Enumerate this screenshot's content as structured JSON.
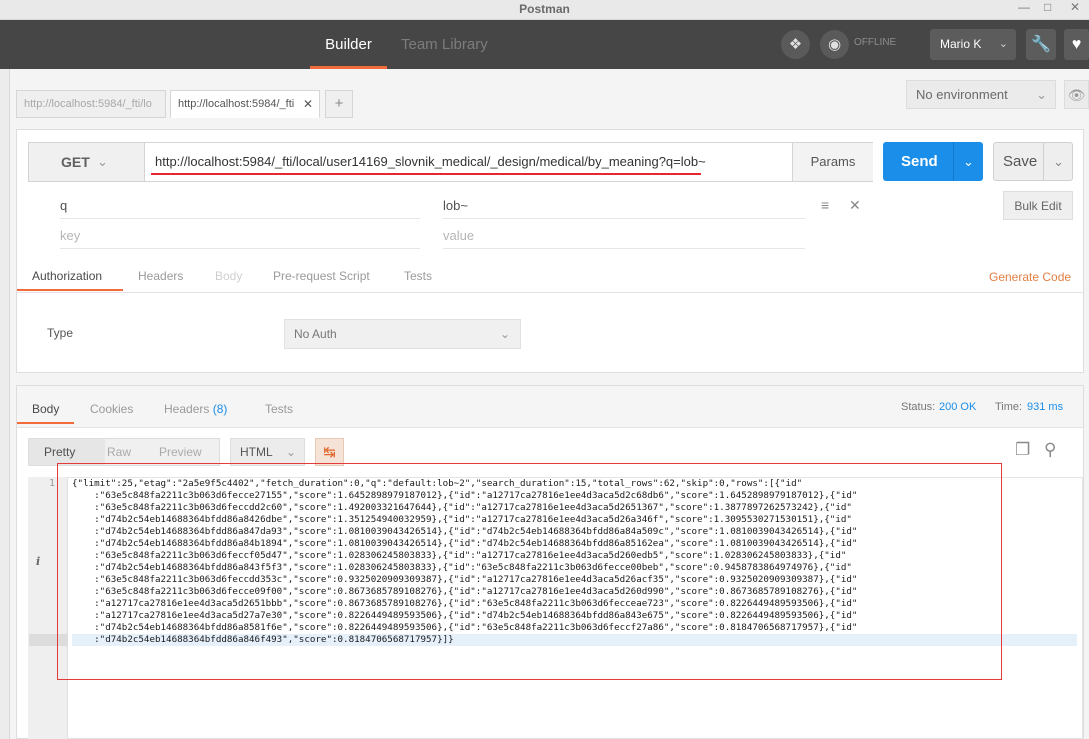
{
  "window": {
    "title": "Postman"
  },
  "nav": {
    "tabs": [
      {
        "label": "Builder"
      },
      {
        "label": "Team Library"
      }
    ],
    "status": "OFFLINE",
    "user": "Mario K"
  },
  "request_tabs": [
    {
      "label": "http://localhost:5984/_fti/lo"
    },
    {
      "label": "http://localhost:5984/_fti"
    }
  ],
  "environment": {
    "selected": "No environment"
  },
  "request": {
    "method": "GET",
    "url": "http://localhost:5984/_fti/local/user14169_slovnik_medical/_design/medical/by_meaning?q=lob~",
    "params_label": "Params",
    "send_label": "Send",
    "save_label": "Save",
    "params": [
      {
        "key": "q",
        "value": "lob~"
      }
    ],
    "key_placeholder": "key",
    "value_placeholder": "value",
    "bulk_edit_label": "Bulk Edit"
  },
  "request_subtabs": [
    {
      "label": "Authorization"
    },
    {
      "label": "Headers"
    },
    {
      "label": "Body"
    },
    {
      "label": "Pre-request Script"
    },
    {
      "label": "Tests"
    }
  ],
  "generate_code_label": "Generate Code",
  "auth": {
    "type_label": "Type",
    "selected": "No Auth"
  },
  "response": {
    "tabs": [
      {
        "label": "Body"
      },
      {
        "label": "Cookies"
      },
      {
        "label": "Headers"
      },
      {
        "label": "Tests"
      }
    ],
    "headers_count": "(8)",
    "status_label": "Status:",
    "status_value": "200 OK",
    "time_label": "Time:",
    "time_value": "931 ms",
    "formats": [
      {
        "label": "Pretty"
      },
      {
        "label": "Raw"
      },
      {
        "label": "Preview"
      }
    ],
    "language": "HTML",
    "line_number": "1",
    "info_marker": "i",
    "body_lines": [
      "{\"limit\":25,\"etag\":\"2a5e9f5c4402\",\"fetch_duration\":0,\"q\":\"default:lob~2\",\"search_duration\":15,\"total_rows\":62,\"skip\":0,\"rows\":[{\"id\"",
      "    :\"63e5c848fa2211c3b063d6fecce27155\",\"score\":1.6452898979187012},{\"id\":\"a12717ca27816e1ee4d3aca5d2c68db6\",\"score\":1.6452898979187012},{\"id\"",
      "    :\"63e5c848fa2211c3b063d6feccdd2c60\",\"score\":1.492003321647644},{\"id\":\"a12717ca27816e1ee4d3aca5d2651367\",\"score\":1.3877897262573242},{\"id\"",
      "    :\"d74b2c54eb14688364bfdd86a8426dbe\",\"score\":1.351254940032959},{\"id\":\"a12717ca27816e1ee4d3aca5d26a346f\",\"score\":1.3095530271530151},{\"id\"",
      "    :\"d74b2c54eb14688364bfdd86a847da93\",\"score\":1.0810039043426514},{\"id\":\"d74b2c54eb14688364bfdd86a84a509c\",\"score\":1.0810039043426514},{\"id\"",
      "    :\"d74b2c54eb14688364bfdd86a84b1894\",\"score\":1.0810039043426514},{\"id\":\"d74b2c54eb14688364bfdd86a85162ea\",\"score\":1.0810039043426514},{\"id\"",
      "    :\"63e5c848fa2211c3b063d6feccf05d47\",\"score\":1.028306245803833},{\"id\":\"a12717ca27816e1ee4d3aca5d260edb5\",\"score\":1.028306245803833},{\"id\"",
      "    :\"d74b2c54eb14688364bfdd86a843f5f3\",\"score\":1.028306245803833},{\"id\":\"63e5c848fa2211c3b063d6fecce00beb\",\"score\":0.9458783864974976},{\"id\"",
      "    :\"63e5c848fa2211c3b063d6feccdd353c\",\"score\":0.9325020909309387},{\"id\":\"a12717ca27816e1ee4d3aca5d26acf35\",\"score\":0.9325020909309387},{\"id\"",
      "    :\"63e5c848fa2211c3b063d6fecce09f00\",\"score\":0.8673685789108276},{\"id\":\"a12717ca27816e1ee4d3aca5d260d990\",\"score\":0.8673685789108276},{\"id\"",
      "    :\"a12717ca27816e1ee4d3aca5d2651bbb\",\"score\":0.8673685789108276},{\"id\":\"63e5c848fa2211c3b063d6fecceae723\",\"score\":0.8226449489593506},{\"id\"",
      "    :\"a12717ca27816e1ee4d3aca5d27a7e30\",\"score\":0.8226449489593506},{\"id\":\"d74b2c54eb14688364bfdd86a843e675\",\"score\":0.8226449489593506},{\"id\"",
      "    :\"d74b2c54eb14688364bfdd86a8581f6e\",\"score\":0.8226449489593506},{\"id\":\"63e5c848fa2211c3b063d6feccf27a86\",\"score\":0.8184706568717957},{\"id\"",
      "    :\"d74b2c54eb14688364bfdd86a846f493\",\"score\":0.8184706568717957}]}"
    ]
  },
  "colors": {
    "accent": "#f26b3a",
    "send": "#1a8ee8",
    "annotation": "#e33a3a",
    "navbar": "#464646"
  }
}
